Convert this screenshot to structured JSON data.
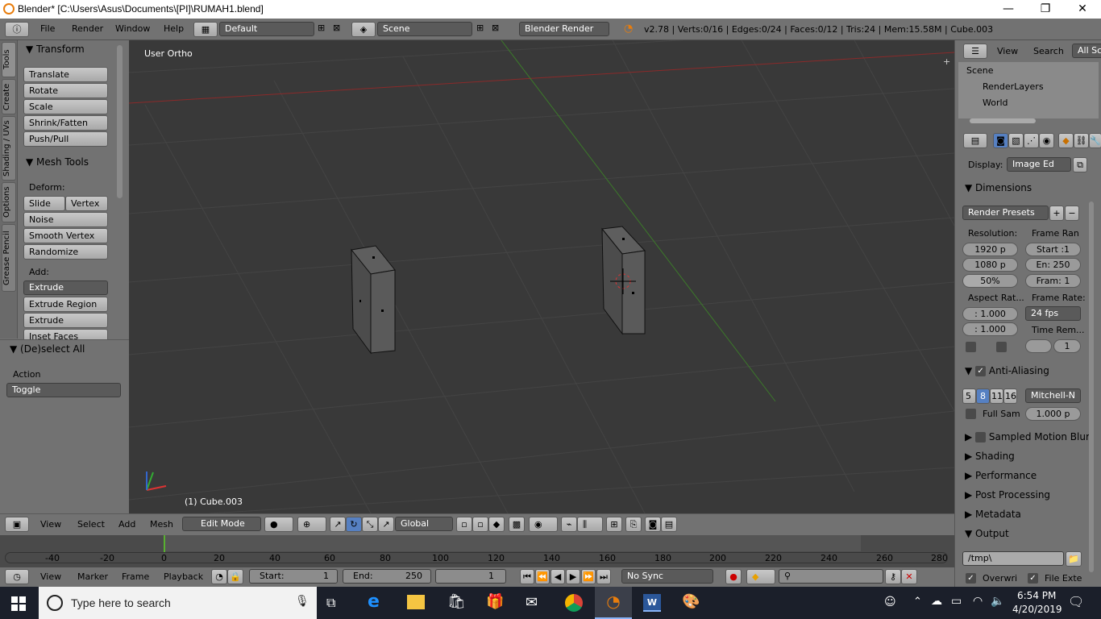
{
  "titlebar": {
    "title": "Blender* [C:\\Users\\Asus\\Documents\\[PI]\\RUMAH1.blend]",
    "minimize": "—",
    "maximize": "❐",
    "close": "✕"
  },
  "topbar": {
    "menus": [
      "File",
      "Render",
      "Window",
      "Help"
    ],
    "screen": "Default",
    "scene": "Scene",
    "engine": "Blender Render",
    "stats": "v2.78 | Verts:0/16 | Edges:0/24 | Faces:0/12 | Tris:24 | Mem:15.58M | Cube.003"
  },
  "tabs": [
    "Tools",
    "Create",
    "Shading / UVs",
    "Options",
    "Grease Pencil"
  ],
  "toolshelf": {
    "transform_header": "Transform",
    "transform_buttons": [
      "Translate",
      "Rotate",
      "Scale",
      "Shrink/Fatten",
      "Push/Pull"
    ],
    "mesh_header": "Mesh Tools",
    "deform_label": "Deform:",
    "slide_edge": "Slide Ed",
    "vertex": "Vertex",
    "deform_buttons": [
      "Noise",
      "Smooth Vertex",
      "Randomize"
    ],
    "add_label": "Add:",
    "extrude": "Extrude",
    "add_buttons": [
      "Extrude Region",
      "Extrude Individual",
      "Inset Faces"
    ],
    "operator_header": "(De)select All",
    "action_label": "Action",
    "action_value": "Toggle"
  },
  "viewport": {
    "view_name": "User Ortho",
    "object_info": "(1) Cube.003"
  },
  "viewbar": {
    "menus": [
      "View",
      "Select",
      "Add",
      "Mesh"
    ],
    "mode": "Edit Mode",
    "orientation": "Global"
  },
  "timeline": {
    "ticks": [
      "-40",
      "-20",
      "0",
      "20",
      "40",
      "60",
      "80",
      "100",
      "120",
      "140",
      "160",
      "180",
      "200",
      "220",
      "240",
      "260",
      "280"
    ],
    "current_frame": 0
  },
  "tlbar": {
    "menus": [
      "View",
      "Marker",
      "Frame",
      "Playback"
    ],
    "start_label": "Start:",
    "start": "1",
    "end_label": "End:",
    "end": "250",
    "current": "1",
    "sync": "No Sync"
  },
  "outliner": {
    "view": "View",
    "search": "Search",
    "filter": "All Sc",
    "items": [
      "Scene",
      "RenderLayers",
      "World"
    ]
  },
  "properties": {
    "display_label": "Display:",
    "display_value": "Image Ed",
    "dimensions": "Dimensions",
    "render_presets": "Render Presets",
    "resolution_label": "Resolution:",
    "res_x": "1920 p",
    "res_y": "1080 p",
    "res_pct": "50%",
    "frame_range_label": "Frame Ran",
    "frame_start": "Start :1",
    "frame_end": "En: 250",
    "frame_step": "Fram: 1",
    "aspect_label": "Aspect Rat...",
    "aspect_x": ": 1.000",
    "aspect_y": ": 1.000",
    "frame_rate_label": "Frame Rate:",
    "fps": "24 fps",
    "time_remap": "Time Rem...",
    "time_remap_val": "1",
    "anti_aliasing": "Anti-Aliasing",
    "aa_samples": [
      "5",
      "8",
      "11",
      "16"
    ],
    "aa_filter": "Mitchell-N",
    "full_sample": "Full Sam",
    "filter_size": "1.000 p",
    "sampled_motion_blur": "Sampled Motion Blur",
    "panels": [
      "Shading",
      "Performance",
      "Post Processing",
      "Metadata"
    ],
    "output": "Output",
    "output_path": "/tmp\\",
    "overwrite": "Overwri",
    "file_ext": "File Exte"
  },
  "taskbar": {
    "search_placeholder": "Type here to search",
    "time": "6:54 PM",
    "date": "4/20/2019"
  },
  "colors": {
    "accent": "#5680c2",
    "x_axis": "#8b2a2a",
    "y_axis": "#3c7a2a",
    "active_frame": "#58b030"
  }
}
